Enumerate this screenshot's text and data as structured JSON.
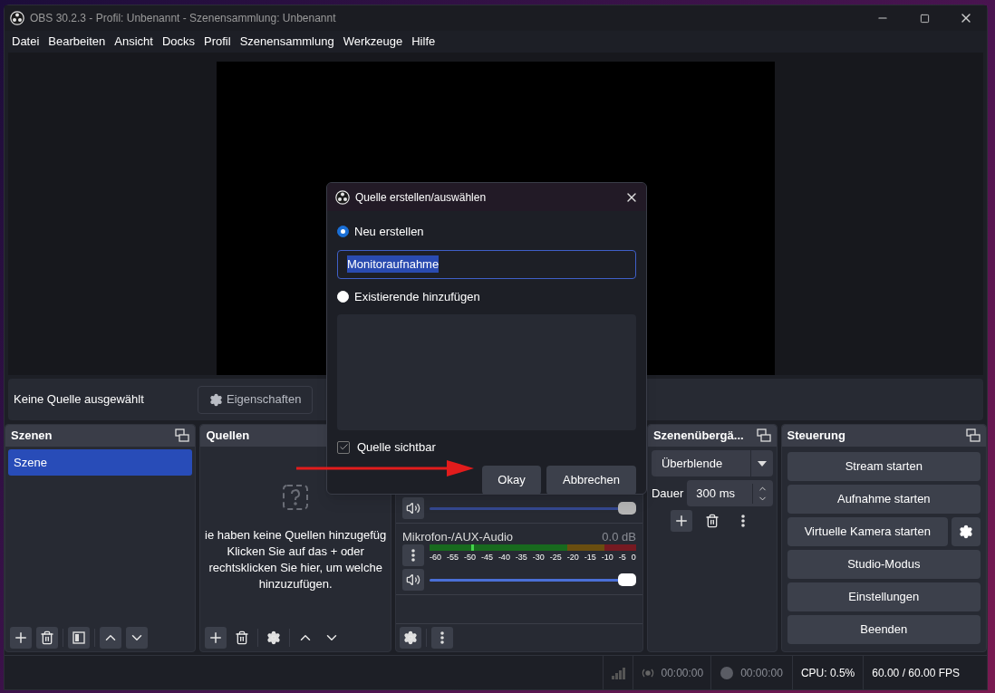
{
  "window": {
    "title": "OBS 30.2.3 - Profil: Unbenannt - Szenensammlung: Unbenannt"
  },
  "menu": [
    "Datei",
    "Bearbeiten",
    "Ansicht",
    "Docks",
    "Profil",
    "Szenensammlung",
    "Werkzeuge",
    "Hilfe"
  ],
  "source_bar": {
    "label": "Keine Quelle ausgewählt",
    "properties_button": "Eigenschaften"
  },
  "scenes": {
    "title": "Szenen",
    "items": [
      {
        "label": "Szene",
        "selected": true
      }
    ]
  },
  "sources": {
    "title": "Quellen",
    "empty_text": [
      "ie haben keine Quellen hinzugefüg",
      "Klicken Sie auf das + oder",
      "rechtsklicken Sie hier, um welche",
      "hinzuzufügen."
    ]
  },
  "mixer": {
    "scale": [
      "-60",
      "-55",
      "-50",
      "-45",
      "-40",
      "-35",
      "-30",
      "-25",
      "-20",
      "-15",
      "-10",
      "-5",
      "0"
    ],
    "channels": [
      {
        "level": 1
      },
      {
        "name": "Mikrofon-/AUX-Audio",
        "reading": "0.0 dB",
        "level": 1
      }
    ]
  },
  "transitions": {
    "title": "Szenenübergä...",
    "type": "Überblende",
    "duration_label": "Dauer",
    "duration": "300 ms"
  },
  "controls": {
    "title": "Steuerung",
    "buttons": [
      {
        "label": "Stream starten",
        "kind": "plain"
      },
      {
        "label": "Aufnahme starten",
        "kind": "plain"
      },
      {
        "label": "Virtuelle Kamera starten",
        "kind": "with_settings"
      },
      {
        "label": "Studio-Modus",
        "kind": "plain"
      },
      {
        "label": "Einstellungen",
        "kind": "plain"
      },
      {
        "label": "Beenden",
        "kind": "plain"
      }
    ]
  },
  "status": {
    "stream_time": "00:00:00",
    "record_time": "00:00:00",
    "cpu": "CPU: 0.5%",
    "fps": "60.00 / 60.00 FPS"
  },
  "dialog": {
    "title": "Quelle erstellen/auswählen",
    "options": [
      {
        "label": "Neu erstellen",
        "selected": true
      },
      {
        "label": "Existierende hinzufügen",
        "selected": false
      }
    ],
    "name_value": "Monitoraufnahme",
    "visible": {
      "label": "Quelle sichtbar",
      "checked": true
    },
    "buttons": [
      "Okay",
      "Abbrechen"
    ]
  }
}
